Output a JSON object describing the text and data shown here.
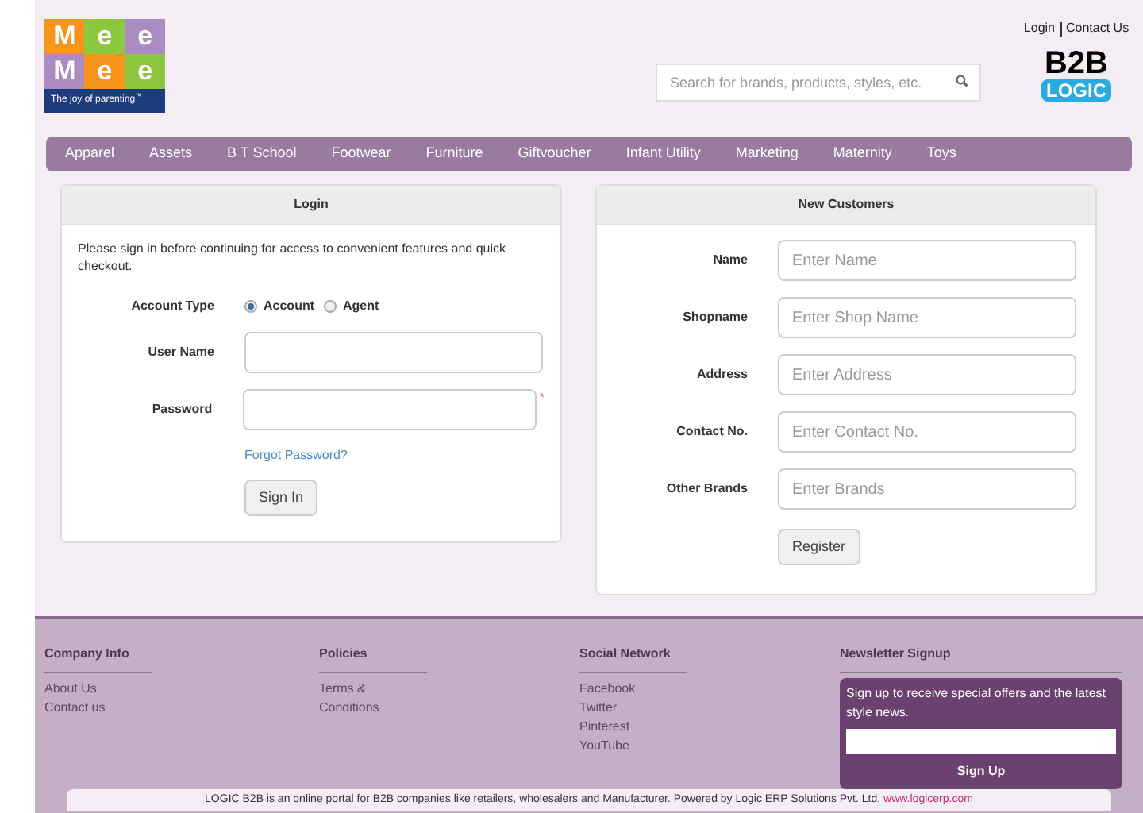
{
  "header": {
    "logo": {
      "tiles": [
        {
          "letter": "M",
          "color": "#f7941d"
        },
        {
          "letter": "e",
          "color": "#8dc63f"
        },
        {
          "letter": "e",
          "color": "#ab8bc1"
        },
        {
          "letter": "M",
          "color": "#ab8bc1"
        },
        {
          "letter": "e",
          "color": "#f7941d"
        },
        {
          "letter": "e",
          "color": "#8dc63f"
        }
      ],
      "tagline": "The joy of parenting",
      "mark": "™"
    },
    "search": {
      "placeholder": "Search for brands, products, styles, etc."
    },
    "top_links": [
      "Login",
      "Contact Us"
    ],
    "brand": {
      "top": "B2B",
      "bottom": "LOGIC"
    }
  },
  "nav": [
    "Apparel",
    "Assets",
    "B T School",
    "Footwear",
    "Furniture",
    "Giftvoucher",
    "Infant Utility",
    "Marketing",
    "Maternity",
    "Toys"
  ],
  "login": {
    "title": "Login",
    "intro": "Please sign in before continuing for access to convenient features and quick checkout.",
    "account_type": {
      "label": "Account Type",
      "options": [
        {
          "label": "Account",
          "selected": true
        },
        {
          "label": "Agent",
          "selected": false
        }
      ]
    },
    "fields": [
      {
        "label": "User Name",
        "required": false
      },
      {
        "label": "Password",
        "required": true
      }
    ],
    "required_mark": "*",
    "forgot": "Forgot Password?",
    "button": "Sign In"
  },
  "new_customers": {
    "title": "New Customers",
    "fields": [
      {
        "label": "Name",
        "placeholder": "Enter Name"
      },
      {
        "label": "Shopname",
        "placeholder": "Enter Shop Name"
      },
      {
        "label": "Address",
        "placeholder": "Enter Address"
      },
      {
        "label": "Contact No.",
        "placeholder": "Enter Contact No."
      },
      {
        "label": "Other Brands",
        "placeholder": "Enter Brands"
      }
    ],
    "button": "Register"
  },
  "footer": {
    "columns": [
      {
        "title": "Company Info",
        "links": [
          "About Us",
          "Contact us"
        ]
      },
      {
        "title": "Policies",
        "links": [
          "Terms &",
          "Conditions"
        ]
      },
      {
        "title": "Social Network",
        "links": [
          "Facebook",
          "Twitter",
          "Pinterest",
          "YouTube"
        ]
      }
    ],
    "newsletter": {
      "title": "Newsletter Signup",
      "text": "Sign up to receive special offers and the latest style news.",
      "button": "Sign Up"
    },
    "bottom": {
      "text": "LOGIC B2B is an online portal for B2B companies like retailers, wholesalers and Manufacturer. Powered by Logic ERP Solutions Pvt. Ltd.",
      "link": "www.logicerp.com"
    }
  }
}
